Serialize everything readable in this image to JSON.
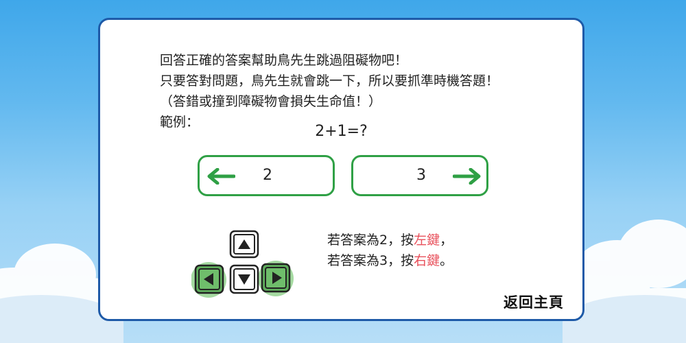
{
  "instructions": {
    "line1": "回答正確的答案幫助鳥先生跳過阻礙物吧！",
    "line2": "只要答對問題，鳥先生就會跳一下，所以要抓準時機答題！",
    "line3": "（答錯或撞到障礙物會損失生命值！）",
    "line4": "範例："
  },
  "example": {
    "equation": "2+1=?",
    "left_answer": "2",
    "right_answer": "3"
  },
  "hint": {
    "line1_prefix": "若答案為2，按",
    "line1_key": "左鍵",
    "line1_suffix": "，",
    "line2_prefix": "若答案為3，按",
    "line2_key": "右鍵",
    "line2_suffix": "。"
  },
  "home_button": "返回主頁",
  "colors": {
    "panel_border": "#1e5aa8",
    "answer_border": "#2fa045",
    "arrow_green": "#2fa045",
    "key_highlight": "#8fd18a",
    "hint_red": "#e8505b"
  },
  "icons": [
    "left-arrow-icon",
    "right-arrow-icon",
    "up-key-icon",
    "down-key-icon",
    "left-key-icon",
    "right-key-icon",
    "cloud-icon"
  ]
}
